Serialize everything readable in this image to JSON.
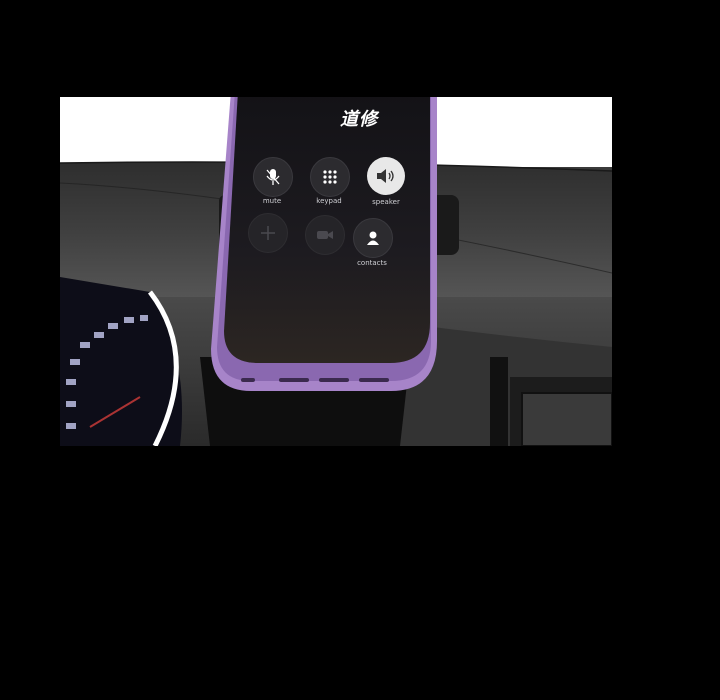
{
  "call_screen": {
    "caller_name": "道修",
    "buttons": [
      {
        "label": "mute",
        "icon": "microphone-icon"
      },
      {
        "label": "keypad",
        "icon": "keypad-icon"
      },
      {
        "label": "speaker",
        "icon": "speaker-icon",
        "active": true
      },
      {
        "label": "",
        "icon": "add-call-icon"
      },
      {
        "label": "",
        "icon": "facetime-icon"
      },
      {
        "label": "contacts",
        "icon": "contacts-icon"
      }
    ]
  },
  "colors": {
    "phone_frame": "#a784c9",
    "background": "#000000",
    "screen": "#1b1a1d"
  }
}
